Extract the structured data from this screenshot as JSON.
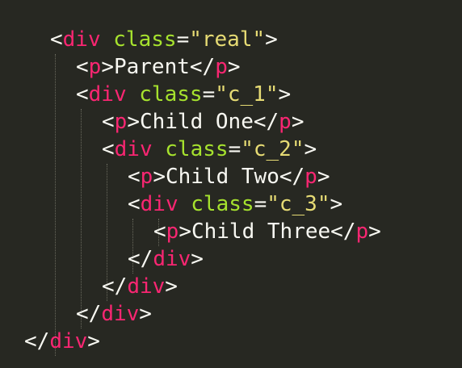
{
  "editor": {
    "theme_colors": {
      "background": "#272822",
      "tag": "#f92672",
      "attribute": "#a6e22e",
      "string": "#e6db74",
      "text": "#f8f8f2"
    },
    "code_lines": [
      {
        "indent": 0,
        "tokens": [
          [
            "punct",
            "<"
          ],
          [
            "tag",
            "div"
          ],
          [
            "punct",
            " "
          ],
          [
            "attr",
            "class"
          ],
          [
            "punct",
            "="
          ],
          [
            "str",
            "\"real\""
          ],
          [
            "punct",
            ">"
          ]
        ]
      },
      {
        "indent": 1,
        "tokens": [
          [
            "punct",
            "<"
          ],
          [
            "tag",
            "p"
          ],
          [
            "punct",
            ">"
          ],
          [
            "text",
            "Parent"
          ],
          [
            "punct",
            "</"
          ],
          [
            "tag",
            "p"
          ],
          [
            "punct",
            ">"
          ]
        ]
      },
      {
        "indent": 1,
        "tokens": [
          [
            "punct",
            "<"
          ],
          [
            "tag",
            "div"
          ],
          [
            "punct",
            " "
          ],
          [
            "attr",
            "class"
          ],
          [
            "punct",
            "="
          ],
          [
            "str",
            "\"c_1\""
          ],
          [
            "punct",
            ">"
          ]
        ]
      },
      {
        "indent": 2,
        "tokens": [
          [
            "punct",
            "<"
          ],
          [
            "tag",
            "p"
          ],
          [
            "punct",
            ">"
          ],
          [
            "text",
            "Child One"
          ],
          [
            "punct",
            "</"
          ],
          [
            "tag",
            "p"
          ],
          [
            "punct",
            ">"
          ]
        ]
      },
      {
        "indent": 2,
        "tokens": [
          [
            "punct",
            "<"
          ],
          [
            "tag",
            "div"
          ],
          [
            "punct",
            " "
          ],
          [
            "attr",
            "class"
          ],
          [
            "punct",
            "="
          ],
          [
            "str",
            "\"c_2\""
          ],
          [
            "punct",
            ">"
          ]
        ]
      },
      {
        "indent": 3,
        "tokens": [
          [
            "punct",
            "<"
          ],
          [
            "tag",
            "p"
          ],
          [
            "punct",
            ">"
          ],
          [
            "text",
            "Child Two"
          ],
          [
            "punct",
            "</"
          ],
          [
            "tag",
            "p"
          ],
          [
            "punct",
            ">"
          ]
        ]
      },
      {
        "indent": 3,
        "tokens": [
          [
            "punct",
            "<"
          ],
          [
            "tag",
            "div"
          ],
          [
            "punct",
            " "
          ],
          [
            "attr",
            "class"
          ],
          [
            "punct",
            "="
          ],
          [
            "str",
            "\"c_3\""
          ],
          [
            "punct",
            ">"
          ]
        ]
      },
      {
        "indent": 4,
        "tokens": [
          [
            "punct",
            "<"
          ],
          [
            "tag",
            "p"
          ],
          [
            "punct",
            ">"
          ],
          [
            "text",
            "Child Three"
          ],
          [
            "punct",
            "</"
          ],
          [
            "tag",
            "p"
          ],
          [
            "punct",
            ">"
          ]
        ]
      },
      {
        "indent": 3,
        "tokens": [
          [
            "punct",
            "</"
          ],
          [
            "tag",
            "div"
          ],
          [
            "punct",
            ">"
          ]
        ]
      },
      {
        "indent": 2,
        "tokens": [
          [
            "punct",
            "</"
          ],
          [
            "tag",
            "div"
          ],
          [
            "punct",
            ">"
          ]
        ]
      },
      {
        "indent": 1,
        "tokens": [
          [
            "punct",
            "</"
          ],
          [
            "tag",
            "div"
          ],
          [
            "punct",
            ">"
          ]
        ]
      },
      {
        "indent": -1,
        "tokens": [
          [
            "punct",
            "</"
          ],
          [
            "tag",
            "div"
          ],
          [
            "punct",
            ">"
          ]
        ]
      }
    ]
  }
}
